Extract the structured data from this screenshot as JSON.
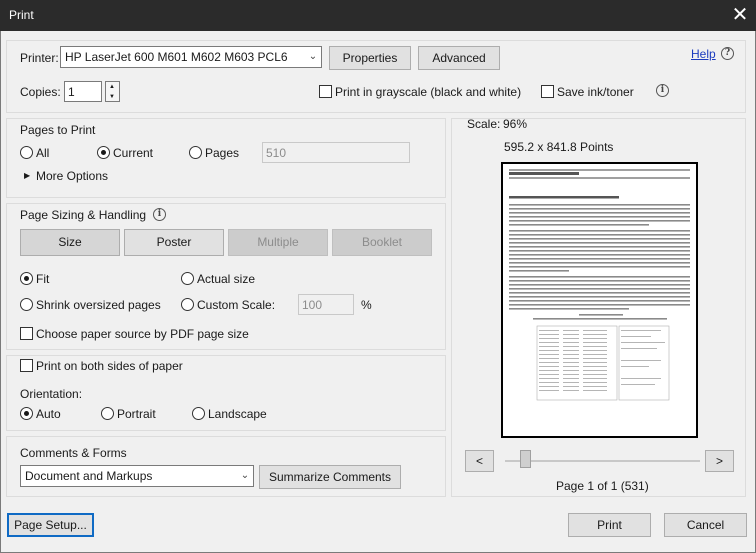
{
  "window": {
    "title": "Print",
    "close_glyph": "✕"
  },
  "printer": {
    "label": "Printer:",
    "selected": "HP LaserJet 600 M601 M602 M603 PCL6",
    "properties_button": "Properties",
    "advanced_button": "Advanced",
    "help_link": "Help",
    "copies_label": "Copies:",
    "copies_value": "1",
    "grayscale_label": "Print in grayscale (black and white)",
    "grayscale_checked": false,
    "save_ink_label": "Save ink/toner",
    "save_ink_checked": false
  },
  "pages_to_print": {
    "heading": "Pages to Print",
    "options": [
      "All",
      "Current",
      "Pages"
    ],
    "selected": "Current",
    "pages_value": "510",
    "more_options": "More Options"
  },
  "sizing": {
    "heading": "Page Sizing & Handling",
    "tabs": [
      {
        "label": "Size",
        "active": true,
        "enabled": true
      },
      {
        "label": "Poster",
        "active": false,
        "enabled": true
      },
      {
        "label": "Multiple",
        "active": false,
        "enabled": false
      },
      {
        "label": "Booklet",
        "active": false,
        "enabled": false
      }
    ],
    "fit_label": "Fit",
    "actual_size_label": "Actual size",
    "shrink_label": "Shrink oversized pages",
    "custom_scale_label": "Custom Scale:",
    "custom_scale_value": "100",
    "percent": "%",
    "selected": "Fit",
    "paper_source_label": "Choose paper source by PDF page size",
    "paper_source_checked": false
  },
  "duplex": {
    "both_sides_label": "Print on both sides of paper",
    "both_sides_checked": false,
    "orientation_label": "Orientation:",
    "options": [
      "Auto",
      "Portrait",
      "Landscape"
    ],
    "selected": "Auto"
  },
  "comments": {
    "heading": "Comments & Forms",
    "selected": "Document and Markups",
    "summarize_button": "Summarize Comments"
  },
  "preview": {
    "scale_label": "Scale:",
    "scale_value": "96%",
    "dimensions": "595.2 x 841.8 Points",
    "prev_glyph": "<",
    "next_glyph": ">",
    "page_status": "Page 1 of 1 (531)",
    "slider_position": 0
  },
  "footer": {
    "page_setup_button": "Page Setup...",
    "print_button": "Print",
    "cancel_button": "Cancel"
  },
  "icons": {
    "info": "i",
    "help": "?",
    "more_arrow": "▶",
    "dropdown": "⌄",
    "spin_up": "▲",
    "spin_down": "▼"
  }
}
